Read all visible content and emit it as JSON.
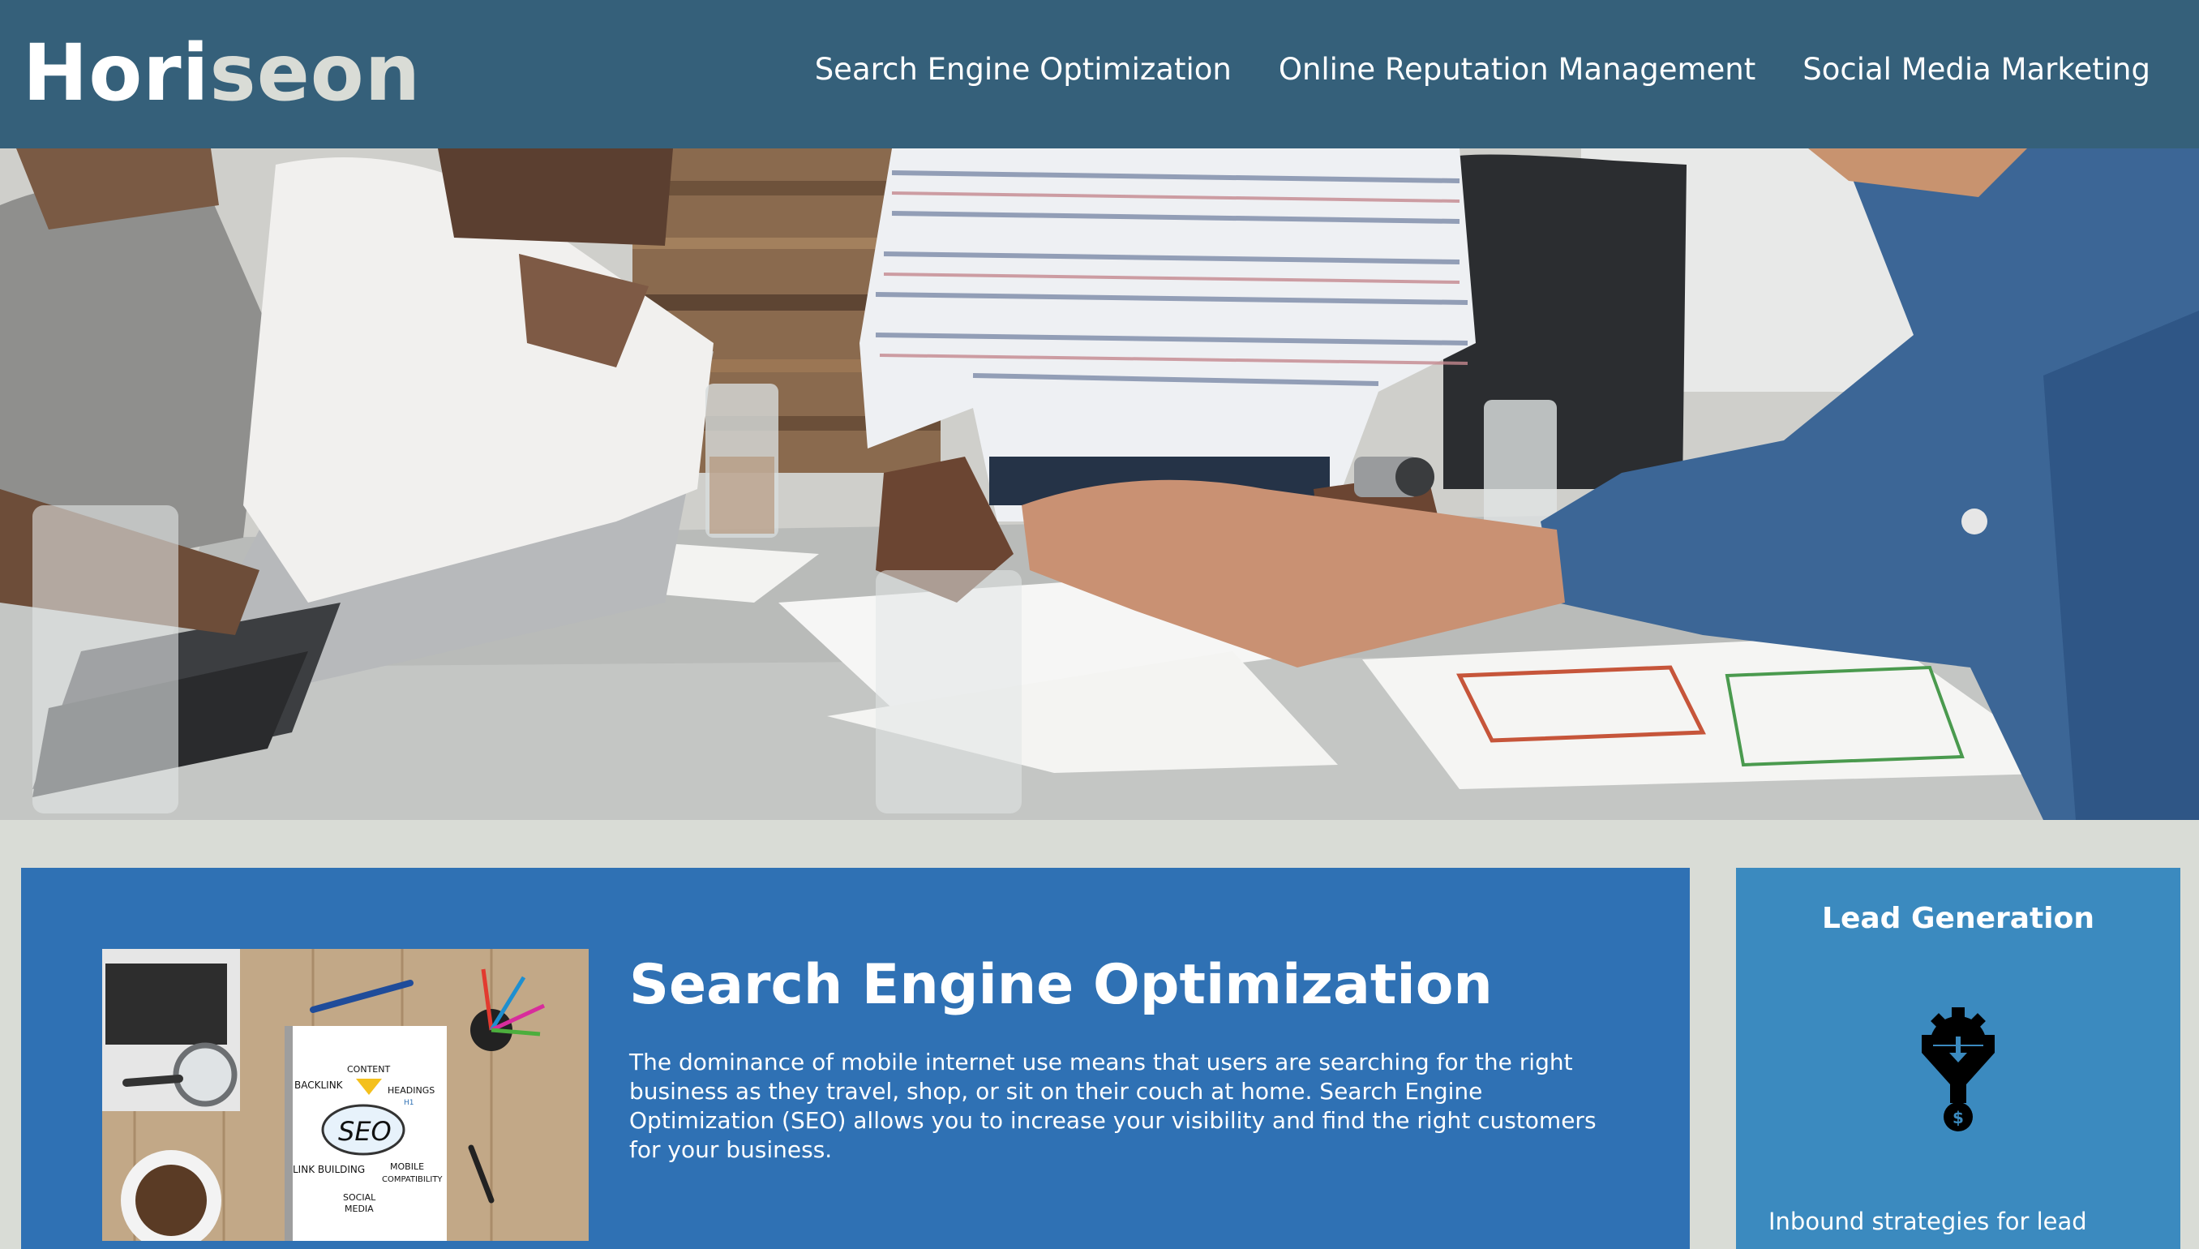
{
  "header": {
    "logo_main": "Hori",
    "logo_accent": "seon",
    "nav": [
      {
        "label": "Search Engine Optimization"
      },
      {
        "label": "Online Reputation Management"
      },
      {
        "label": "Social Media Marketing"
      }
    ]
  },
  "content": {
    "title": "Search Engine Optimization",
    "text": "The dominance of mobile internet use means that users are searching for the right business as they travel, shop, or sit on their couch at home. Search Engine Optimization (SEO) allows you to increase your visibility and find the right customers for your business.",
    "image_labels": {
      "content": "CONTENT",
      "backlink": "BACKLINK",
      "headings": "HEADINGS",
      "h1": "H1",
      "seo": "SEO",
      "link_building": "LINK BUILDING",
      "mobile": "MOBILE",
      "compatibility": "COMPATIBILITY",
      "social": "SOCIAL",
      "media": "MEDIA"
    }
  },
  "aside": {
    "title": "Lead Generation",
    "text": "Inbound strategies for lead",
    "icon": "lead-generation-icon"
  },
  "colors": {
    "header_bg": "#35607a",
    "page_bg": "#d9dcd6",
    "content_bg": "#2f71b4",
    "aside_bg": "#3b8abf",
    "logo_accent": "#d9dcd6"
  }
}
